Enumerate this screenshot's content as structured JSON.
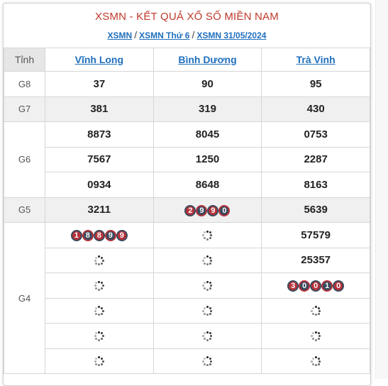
{
  "header": {
    "title": "XSMN - KẾT QUẢ XỔ SỐ MIỀN NAM",
    "crumbs": [
      "XSMN",
      "XSMN Thứ 6",
      "XSMN 31/05/2024"
    ],
    "sep": "/"
  },
  "table": {
    "corner": "Tỉnh",
    "provinces": [
      "Vĩnh Long",
      "Bình Dương",
      "Trà Vinh"
    ],
    "g8": {
      "label": "G8",
      "values": [
        "37",
        "90",
        "95"
      ]
    },
    "g7": {
      "label": "G7",
      "values": [
        "381",
        "319",
        "430"
      ]
    },
    "g6": {
      "label": "G6",
      "rows": [
        [
          "8873",
          "8045",
          "0753"
        ],
        [
          "7567",
          "1250",
          "2287"
        ],
        [
          "0934",
          "8648",
          "8163"
        ]
      ]
    },
    "g5": {
      "label": "G5",
      "values": [
        "3211",
        "2990",
        "5639"
      ],
      "rolling": [
        false,
        true,
        false
      ]
    },
    "g4": {
      "label": "G4",
      "row1": {
        "c1": "18899",
        "c3": "57579"
      },
      "row2": {
        "c3": "25357"
      },
      "row3": {
        "c3": "30010"
      }
    }
  },
  "colors": {
    "accent": "#c0392b",
    "link": "#1f6fbd",
    "ball_red": "#b5323a",
    "ball_navy": "#3a4a5e"
  },
  "icons": {
    "loading": "loading-spinner-icon"
  }
}
